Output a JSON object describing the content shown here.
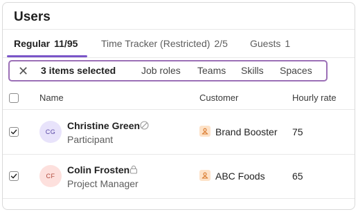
{
  "page": {
    "title": "Users"
  },
  "tabs": [
    {
      "label": "Regular",
      "count": "11/95",
      "active": true
    },
    {
      "label": "Time Tracker (Restricted)",
      "count": "2/5",
      "active": false
    },
    {
      "label": "Guests",
      "count": "1",
      "active": false
    }
  ],
  "selection_bar": {
    "close_icon": "close-icon",
    "summary": "3 items selected",
    "actions": [
      "Job roles",
      "Teams",
      "Skills",
      "Spaces"
    ]
  },
  "table": {
    "columns": [
      "Name",
      "Customer",
      "Hourly rate"
    ],
    "rows": [
      {
        "checked": true,
        "initials": "CG",
        "avatar_bg": "#e8e3fb",
        "avatar_fg": "#5b4aa6",
        "name": "Christine Green",
        "status_icon": "circle-slash-icon",
        "role": "Participant",
        "customer_icon": "org-icon",
        "customer": "Brand Booster",
        "rate": "75"
      },
      {
        "checked": true,
        "initials": "CF",
        "avatar_bg": "#fde0dd",
        "avatar_fg": "#b04a3c",
        "name": "Colin Frosten",
        "status_icon": "lock-icon",
        "role": "Project Manager",
        "customer_icon": "org-icon",
        "customer": "ABC Foods",
        "rate": "65"
      }
    ]
  },
  "colors": {
    "accent": "#7a55c8",
    "selection_border": "#9b6fb6",
    "customer_icon_bg": "#fde2c8",
    "customer_icon_fg": "#d9792c"
  }
}
